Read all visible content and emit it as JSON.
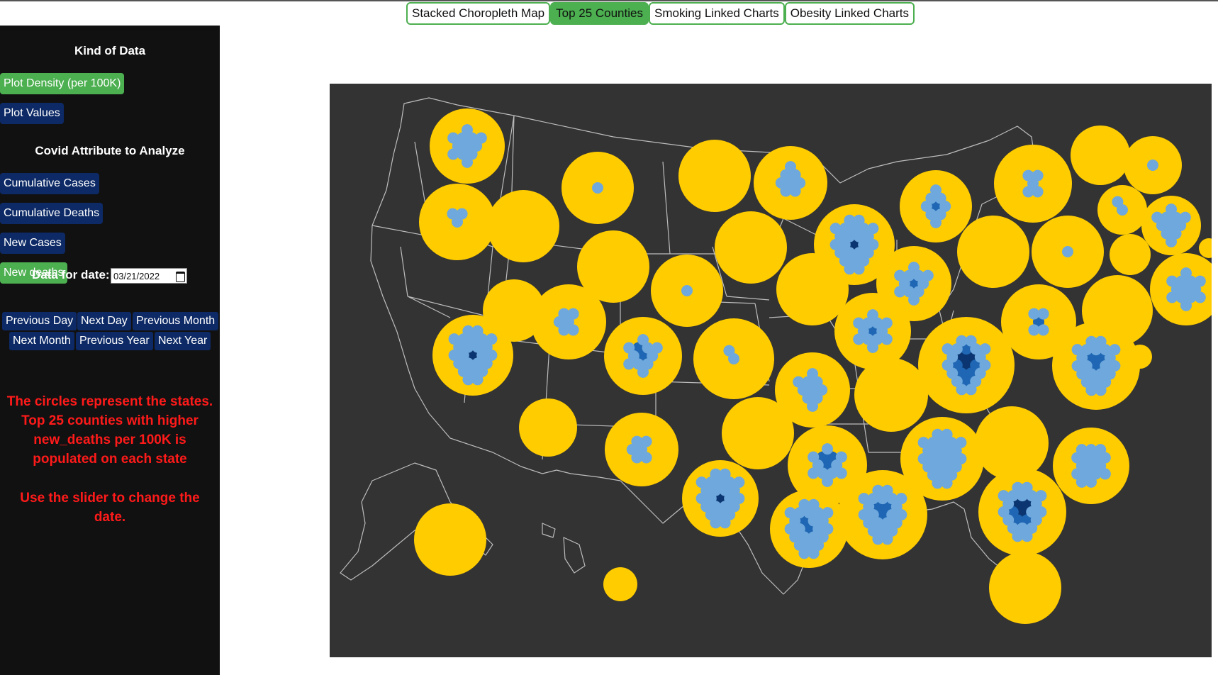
{
  "tabs": [
    {
      "label": "Stacked Choropleth Map",
      "active": false
    },
    {
      "label": "Top 25 Counties",
      "active": true
    },
    {
      "label": "Smoking Linked Charts",
      "active": false
    },
    {
      "label": "Obesity Linked Charts",
      "active": false
    }
  ],
  "sidebar": {
    "kind_heading": "Kind of Data",
    "plot_density": "Plot Density (per 100K)",
    "plot_values": "Plot Values",
    "attribute_heading": "Covid Attribute to Analyze",
    "cumulative_cases": "Cumulative Cases",
    "cumulative_deaths": "Cumulative Deaths",
    "new_cases": "New Cases",
    "new_deaths": "New deaths",
    "date_label": "Data for date:",
    "date_value": "03/21/2022",
    "nav": {
      "previous_day": "Previous Day",
      "next_day": "Next Day",
      "previous_month": "Previous Month",
      "next_month": "Next Month",
      "previous_year": "Previous Year",
      "next_year": "Next Year"
    },
    "note1": "The circles represent the states. Top 25 counties with higher new_deaths per 100K is populated on each state",
    "note2": "Use the slider to change the date."
  },
  "colors": {
    "active_green": "#4caf50",
    "button_navy": "#0d2a66",
    "state_circle": "#ffcc00",
    "county_light": "#6fa8dc",
    "county_mid": "#1f67b4",
    "county_dark": "#0b3570",
    "map_background": "#333333",
    "note_red": "#ff1a1a"
  }
}
